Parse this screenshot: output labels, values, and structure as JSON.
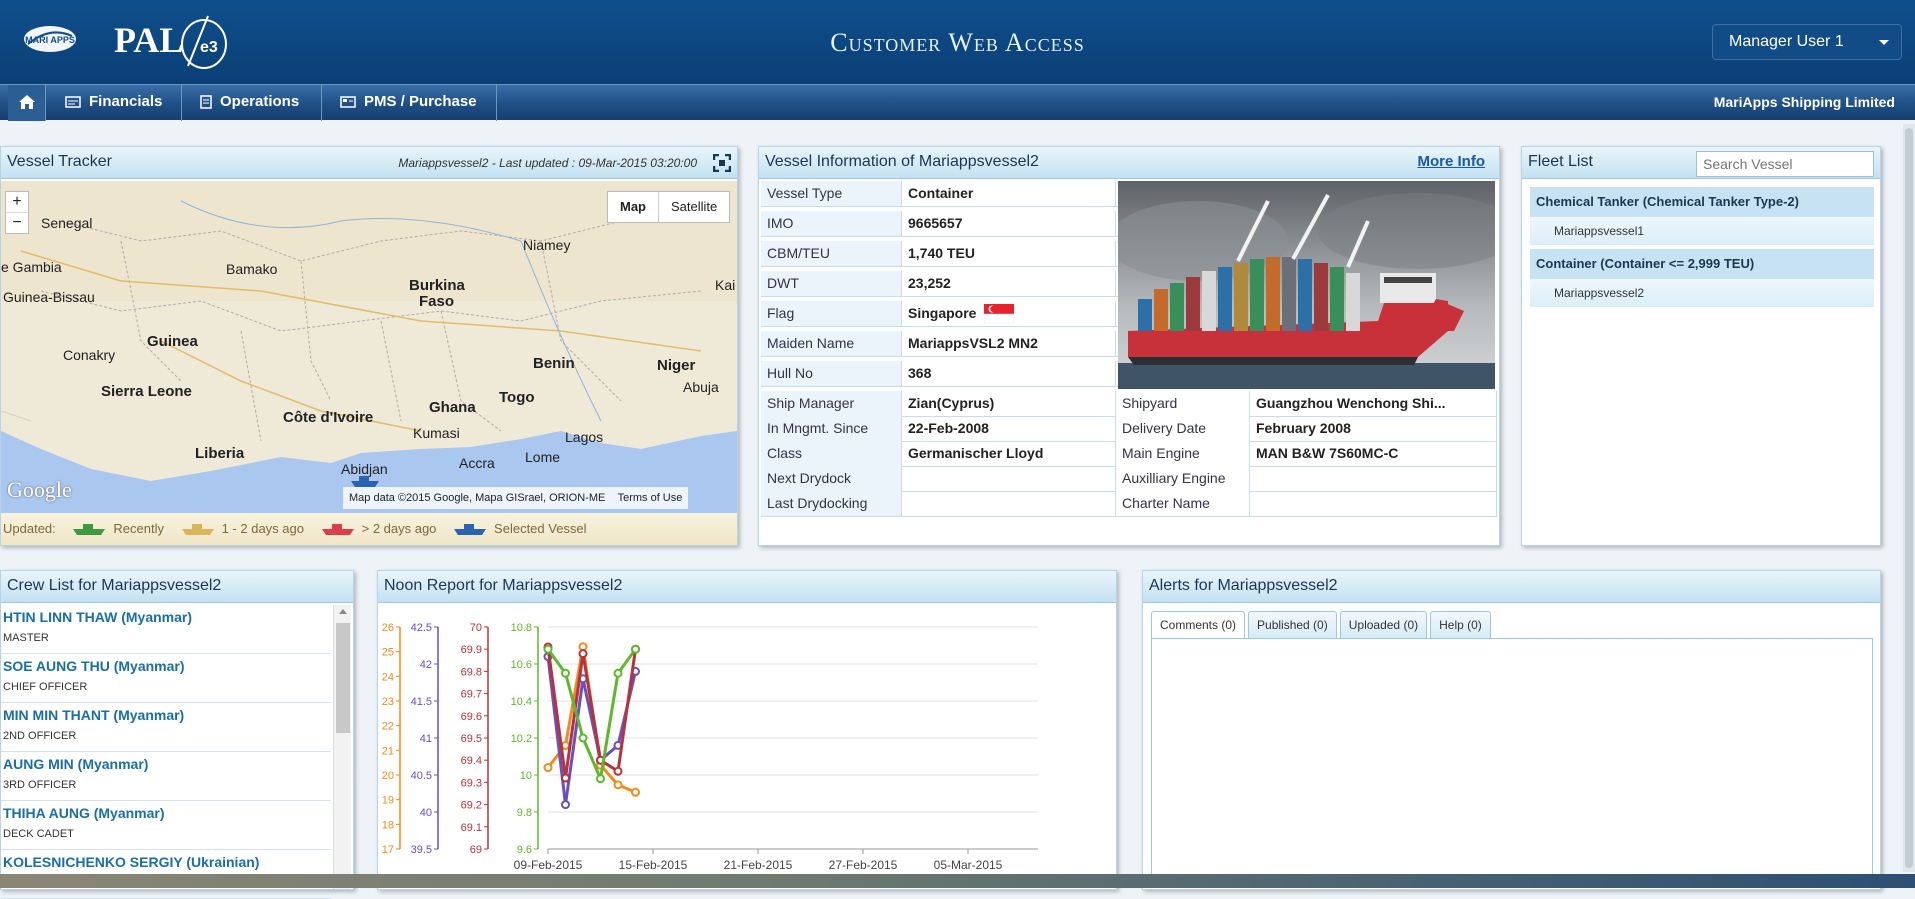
{
  "header": {
    "logo_mari": "MARI APPS",
    "logo_pal": "PAL",
    "logo_e3": "e3",
    "title": "Customer Web Access",
    "user": "Manager User 1"
  },
  "nav": {
    "items": [
      {
        "label": "Financials",
        "icon": "dollar-icon"
      },
      {
        "label": "Operations",
        "icon": "document-icon"
      },
      {
        "label": "PMS / Purchase",
        "icon": "cart-icon"
      }
    ],
    "company": "MariApps Shipping Limited"
  },
  "vessel_tracker": {
    "title": "Vessel Tracker",
    "last_updated": "Mariappsvessel2 - Last updated : 09-Mar-2015 03:20:00",
    "map_button": "Map",
    "satellite_button": "Satellite",
    "zoom_in": "+",
    "zoom_out": "−",
    "google": "Google",
    "attribution": "Map data ©2015 Google, Mapa GISrael, ORION-ME",
    "terms": "Terms of Use",
    "places": [
      "Senegal",
      "e Gambia",
      "Guinea-Bissau",
      "Bamako",
      "Niamey",
      "Burkina",
      "Faso",
      "Guinea",
      "Conakry",
      "Sierra Leone",
      "Côte d'Ivoire",
      "Liberia",
      "Ghana",
      "Kumasi",
      "Togo",
      "Benin",
      "Niger",
      "Abuja",
      "Lagos",
      "Lome",
      "Accra",
      "Abidjan",
      "Kai"
    ],
    "legend": {
      "prefix": "Updated:",
      "recently": "Recently",
      "days_1_2": "1 - 2 days ago",
      "days_gt2": "> 2 days ago",
      "selected": "Selected Vessel",
      "colors": {
        "recently": "#3e9a3c",
        "days_1_2": "#d8b65a",
        "days_gt2": "#d8404a",
        "selected": "#2a64b0"
      }
    }
  },
  "vessel_info": {
    "title": "Vessel Information of Mariappsvessel2",
    "more_info": "More Info",
    "left_rows": [
      {
        "label": "Vessel Type",
        "value": "Container"
      },
      {
        "label": "IMO",
        "value": "9665657"
      },
      {
        "label": "CBM/TEU",
        "value": "1,740 TEU"
      },
      {
        "label": "DWT",
        "value": "23,252"
      },
      {
        "label": "Flag",
        "value": "Singapore"
      },
      {
        "label": "Maiden Name",
        "value": "MariappsVSL2 MN2"
      },
      {
        "label": "Hull No",
        "value": "368"
      }
    ],
    "full_rows": [
      {
        "label": "Ship Manager",
        "value": "Zian(Cyprus)",
        "label2": "Shipyard",
        "value2": "Guangzhou Wenchong Shi..."
      },
      {
        "label": "In Mngmt. Since",
        "value": "22-Feb-2008",
        "label2": "Delivery Date",
        "value2": "February 2008"
      },
      {
        "label": "Class",
        "value": "Germanischer Lloyd",
        "label2": "Main Engine",
        "value2": "MAN B&W 7S60MC-C"
      },
      {
        "label": "Next Drydock",
        "value": "",
        "label2": "Auxilliary Engine",
        "value2": ""
      },
      {
        "label": "Last Drydocking",
        "value": "",
        "label2": "Charter Name",
        "value2": ""
      }
    ]
  },
  "fleet_list": {
    "title": "Fleet List",
    "search_placeholder": "Search Vessel",
    "groups": [
      {
        "name": "Chemical Tanker (Chemical Tanker Type-2)",
        "vessels": [
          "Mariappsvessel1"
        ]
      },
      {
        "name": "Container (Container <= 2,999 TEU)",
        "vessels": [
          "Mariappsvessel2"
        ]
      }
    ]
  },
  "crew_list": {
    "title": "Crew List for Mariappsvessel2",
    "members": [
      {
        "name": "HTIN LINN THAW (Myanmar)",
        "role": "MASTER"
      },
      {
        "name": "SOE AUNG THU (Myanmar)",
        "role": "CHIEF OFFICER"
      },
      {
        "name": "MIN MIN THANT (Myanmar)",
        "role": "2ND OFFICER"
      },
      {
        "name": "AUNG MIN (Myanmar)",
        "role": "3RD OFFICER"
      },
      {
        "name": "THIHA AUNG (Myanmar)",
        "role": "DECK CADET"
      },
      {
        "name": "KOLESNICHENKO SERGIY (Ukrainian)",
        "role": ""
      }
    ]
  },
  "noon_report": {
    "title": "Noon Report for Mariappsvessel2"
  },
  "chart_data": {
    "type": "line",
    "title": "",
    "x": [
      "09-Feb-2015",
      "10-Feb-2015",
      "11-Feb-2015",
      "12-Feb-2015",
      "13-Feb-2015",
      "14-Feb-2015"
    ],
    "x_ticks": [
      "09-Feb-2015",
      "15-Feb-2015",
      "21-Feb-2015",
      "27-Feb-2015",
      "05-Mar-2015"
    ],
    "x_range": [
      "09-Feb-2015",
      "09-Mar-2015"
    ],
    "grid": true,
    "axes": [
      {
        "color": "#f28a1e",
        "ticks": [
          "17",
          "18",
          "19",
          "20",
          "21",
          "22",
          "23",
          "24",
          "25",
          "26"
        ],
        "range": [
          17,
          26
        ]
      },
      {
        "color": "#6a4fbf",
        "ticks": [
          "39.5",
          "40",
          "40.5",
          "41",
          "41.5",
          "42",
          "42.5"
        ],
        "range": [
          39.5,
          42.5
        ]
      },
      {
        "color": "#b8323c",
        "ticks": [
          "69",
          "69.1",
          "69.2",
          "69.3",
          "69.4",
          "69.5",
          "69.6",
          "69.7",
          "69.8",
          "69.9",
          "70"
        ],
        "range": [
          69,
          70
        ]
      },
      {
        "color": "#5db82b",
        "ticks": [
          "9.6",
          "9.8",
          "10",
          "10.2",
          "10.4",
          "10.6",
          "10.8"
        ],
        "range": [
          9.6,
          10.8
        ]
      }
    ],
    "series": [
      {
        "axis": 0,
        "color": "#f28a1e",
        "values": [
          20.3,
          21.2,
          25.2,
          20.4,
          19.6,
          19.3
        ]
      },
      {
        "axis": 1,
        "color": "#6a4fbf",
        "values": [
          42.1,
          40.1,
          41.8,
          40.7,
          40.9,
          41.9
        ]
      },
      {
        "axis": 2,
        "color": "#b8323c",
        "values": [
          69.91,
          69.32,
          69.88,
          69.4,
          69.35,
          69.9
        ]
      },
      {
        "axis": 3,
        "color": "#5db82b",
        "values": [
          10.68,
          10.55,
          10.2,
          9.98,
          10.55,
          10.68
        ]
      }
    ]
  },
  "alerts": {
    "title": "Alerts for Mariappsvessel2",
    "tabs": [
      "Comments (0)",
      "Published (0)",
      "Uploaded (0)",
      "Help (0)"
    ]
  }
}
